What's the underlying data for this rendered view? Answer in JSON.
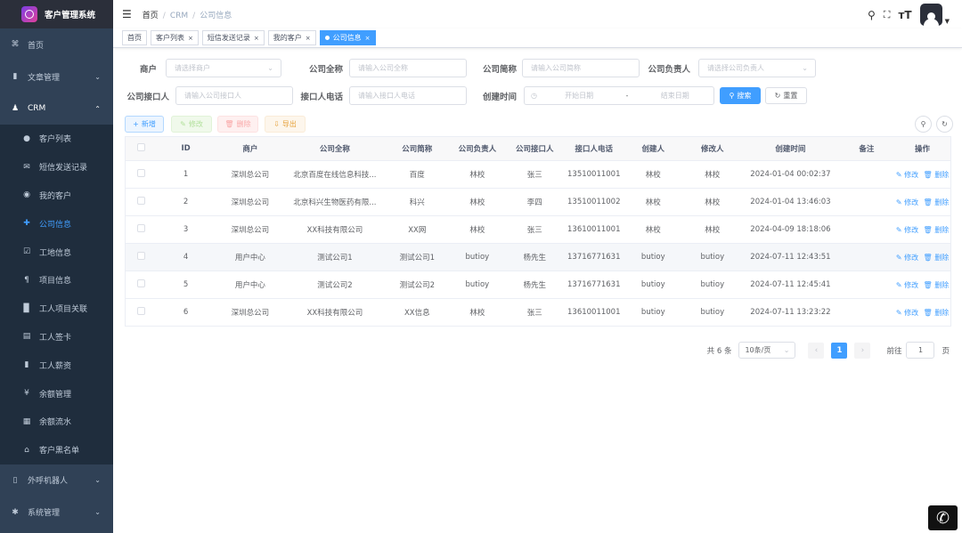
{
  "app": {
    "title": "客户管理系统"
  },
  "sidebar": {
    "home": "首页",
    "article": "文章管理",
    "crm": "CRM",
    "crm_items": [
      {
        "label": "客户列表",
        "icon": "user-icon"
      },
      {
        "label": "短信发送记录",
        "icon": "mail-icon"
      },
      {
        "label": "我的客户",
        "icon": "target-icon"
      },
      {
        "label": "公司信息",
        "icon": "plus-icon"
      },
      {
        "label": "工地信息",
        "icon": "check-icon"
      },
      {
        "label": "项目信息",
        "icon": "doc-icon"
      },
      {
        "label": "工人项目关联",
        "icon": "book-icon"
      },
      {
        "label": "工人签卡",
        "icon": "card-icon"
      },
      {
        "label": "工人薪资",
        "icon": "money-icon"
      },
      {
        "label": "余额管理",
        "icon": "yen-icon"
      },
      {
        "label": "余额流水",
        "icon": "flow-icon"
      },
      {
        "label": "客户黑名单",
        "icon": "house-icon"
      }
    ],
    "robot": "外呼机器人",
    "system": "系统管理"
  },
  "breadcrumb": {
    "home": "首页",
    "crm": "CRM",
    "current": "公司信息"
  },
  "tags": [
    "首页",
    "客户列表",
    "短信发送记录",
    "我的客户",
    "公司信息"
  ],
  "filters": {
    "merchant_label": "商户",
    "merchant_ph": "请选择商户",
    "fullname_label": "公司全称",
    "fullname_ph": "请输入公司全称",
    "shortname_label": "公司简称",
    "shortname_ph": "请输入公司简称",
    "manager_label": "公司负责人",
    "manager_ph": "请选择公司负责人",
    "contact_label": "公司接口人",
    "contact_ph": "请输入公司接口人",
    "phone_label": "接口人电话",
    "phone_ph": "请输入接口人电话",
    "created_label": "创建时间",
    "start_ph": "开始日期",
    "dash": "-",
    "end_ph": "结束日期",
    "search": "搜索",
    "reset": "重置"
  },
  "toolbar": {
    "add": "新增",
    "edit": "修改",
    "delete": "删除",
    "export": "导出"
  },
  "table": {
    "headers": [
      "ID",
      "商户",
      "公司全称",
      "公司简称",
      "公司负责人",
      "公司接口人",
      "接口人电话",
      "创建人",
      "修改人",
      "创建时间",
      "备注",
      "操作"
    ],
    "rows": [
      [
        "1",
        "深圳总公司",
        "北京百度在线信息科技...",
        "百度",
        "林校",
        "张三",
        "13510011001",
        "林校",
        "林校",
        "2024-01-04 00:02:37",
        ""
      ],
      [
        "2",
        "深圳总公司",
        "北京科兴生物医药有限...",
        "科兴",
        "林校",
        "李四",
        "13510011002",
        "林校",
        "林校",
        "2024-01-04 13:46:03",
        ""
      ],
      [
        "3",
        "深圳总公司",
        "XX科技有限公司",
        "XX网",
        "林校",
        "张三",
        "13610011001",
        "林校",
        "林校",
        "2024-04-09 18:18:06",
        ""
      ],
      [
        "4",
        "用户中心",
        "测试公司1",
        "测试公司1",
        "butioy",
        "杨先生",
        "13716771631",
        "butioy",
        "butioy",
        "2024-07-11 12:43:51",
        ""
      ],
      [
        "5",
        "用户中心",
        "测试公司2",
        "测试公司2",
        "butioy",
        "杨先生",
        "13716771631",
        "butioy",
        "butioy",
        "2024-07-11 12:45:41",
        ""
      ],
      [
        "6",
        "深圳总公司",
        "XX科技有限公司",
        "XX信息",
        "林校",
        "张三",
        "13610011001",
        "butioy",
        "butioy",
        "2024-07-11 13:23:22",
        ""
      ]
    ],
    "edit": "修改",
    "delete": "删除"
  },
  "pager": {
    "total": "共 6 条",
    "size": "10条/页",
    "page": "1",
    "goto": "前往",
    "goto_val": "1",
    "unit": "页"
  },
  "colors": {
    "sidebar": "#304156",
    "accent": "#409eff"
  }
}
